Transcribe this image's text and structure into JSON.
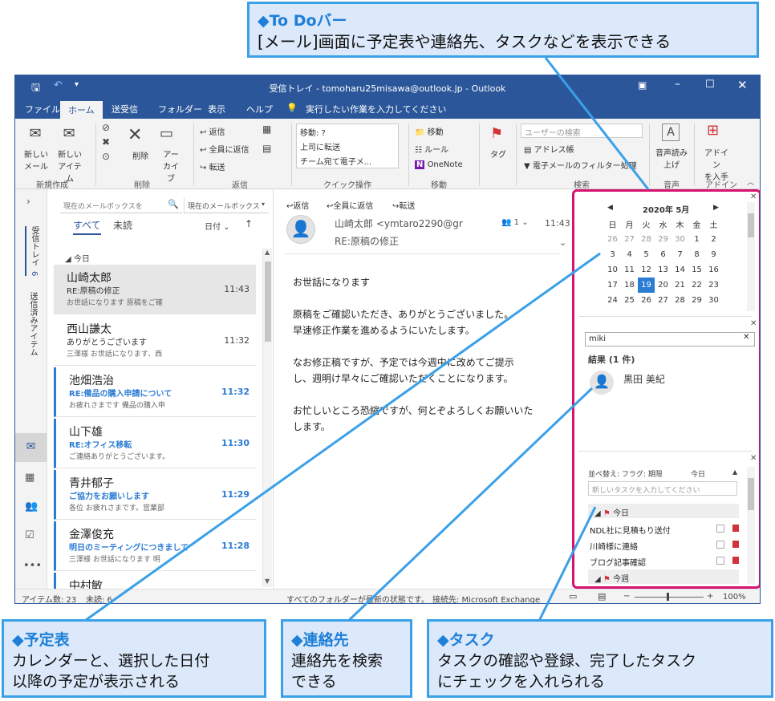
{
  "window": {
    "title": "受信トレイ - tomoharu25misawa@outlook.jp - Outlook"
  },
  "menu": [
    "ファイル",
    "ホーム",
    "送受信",
    "フォルダー",
    "表示",
    "ヘルプ"
  ],
  "tell_me": "実行したい作業を入力してください",
  "ribbon": {
    "new_mail": "新しい\nメール",
    "new_items": "新しい\nアイテム",
    "group_new": "新規作成",
    "delete": "削除",
    "archive": "アー\nカイブ",
    "group_delete": "削除",
    "reply": "返信",
    "reply_all": "全員に返信",
    "forward": "転送",
    "group_respond": "返信",
    "quick_steps": [
      "移動: ?",
      "上司に転送",
      "チーム宛て電子メ..."
    ],
    "group_quick": "クイック操作",
    "move": "移動",
    "rules": "ルール",
    "onenote": "OneNote",
    "group_move": "移動",
    "tags": "タグ",
    "search_people": "ユーザーの検索",
    "address_book": "アドレス帳",
    "filter_mail": "電子メールのフィルター処理",
    "group_find": "検索",
    "read_aloud": "音声読み\n上げ",
    "group_speech": "音声",
    "addins": "アドイン\nを入手",
    "group_addins": "アドイン"
  },
  "leftnav": {
    "inbox_label": "受信トレイ",
    "inbox_count": "6",
    "sent_label": "送信済みアイテム"
  },
  "mailbox_search": {
    "placeholder": "現在のメールボックスを",
    "scope": "現在のメールボックス"
  },
  "filters": {
    "all": "すべて",
    "unread": "未読",
    "sort": "日付"
  },
  "group_today": "今日",
  "messages": [
    {
      "sender": "山崎太郎",
      "subject": "RE:原稿の修正",
      "time": "11:43",
      "preview": "お世話になります 原稿をご確",
      "unread": false,
      "selected": true
    },
    {
      "sender": "西山謙太",
      "subject": "ありがとうございます",
      "time": "11:32",
      "preview": "三澤様 お世話になります、西",
      "unread": false,
      "selected": false
    },
    {
      "sender": "池畑浩治",
      "subject": "RE:備品の購入申請について",
      "time": "11:32",
      "preview": "お疲れさまです 備品の購入申",
      "unread": true,
      "selected": false
    },
    {
      "sender": "山下雄",
      "subject": "RE:オフィス移転",
      "time": "11:30",
      "preview": "ご連絡ありがとうございます。",
      "unread": true,
      "selected": false
    },
    {
      "sender": "青井郁子",
      "subject": "ご協力をお願いします",
      "time": "11:29",
      "preview": "各位 お疲れさまです。営業部",
      "unread": true,
      "selected": false
    },
    {
      "sender": "金澤俊充",
      "subject": "明日のミーティングにつきまして",
      "time": "11:28",
      "preview": "三澤様 お世話になります 明",
      "unread": true,
      "selected": false
    },
    {
      "sender": "中村敏",
      "subject": "",
      "time": "",
      "preview": "",
      "unread": true,
      "selected": false
    }
  ],
  "reading": {
    "actions": [
      "返信",
      "全員に返信",
      "転送"
    ],
    "from": "山崎太郎 <ymtaro2290@gr",
    "people_count": "1",
    "time": "11:43",
    "subject": "RE:原稿の修正",
    "body": [
      "お世話になります",
      "",
      "原稿をご確認いただき、ありがとうございました。",
      "早速修正作業を進めるようにいたします。",
      "",
      "なお修正稿ですが、予定では今週中に改めてご提示",
      "し、週明け早々にご確認いただくことになります。",
      "",
      "お忙しいところ恐縮ですが、何とぞよろしくお願いいた",
      "します。"
    ]
  },
  "calendar": {
    "month": "2020年 5月",
    "weekdays": [
      "日",
      "月",
      "火",
      "水",
      "木",
      "金",
      "土"
    ],
    "weeks": [
      [
        "26",
        "27",
        "28",
        "29",
        "30",
        "1",
        "2"
      ],
      [
        "3",
        "4",
        "5",
        "6",
        "7",
        "8",
        "9"
      ],
      [
        "10",
        "11",
        "12",
        "13",
        "14",
        "15",
        "16"
      ],
      [
        "17",
        "18",
        "19",
        "20",
        "21",
        "22",
        "23"
      ],
      [
        "24",
        "25",
        "26",
        "27",
        "28",
        "29",
        "30"
      ]
    ],
    "today": "19"
  },
  "people": {
    "search_value": "miki",
    "result_header": "結果 (1 件)",
    "result_name": "黒田 美紀"
  },
  "tasks": {
    "sort_label": "並べ替え: フラグ: 期限",
    "sort_value": "今日",
    "new_placeholder": "新しいタスクを入力してください",
    "group_today": "今日",
    "items": [
      "NDL社に見積もり送付",
      "川崎様に連絡",
      "ブログ記事確認"
    ],
    "group_week": "今週"
  },
  "status": {
    "items": "アイテム数: 23",
    "unread": "未読: 6",
    "sync": "すべてのフォルダーが最新の状態です。",
    "connection": "接続先: Microsoft Exchange",
    "zoom": "100%"
  },
  "callouts": {
    "todo_title": "◆To Doバー",
    "todo_body": "[メール]画面に予定表や連絡先、タスクなどを表示できる",
    "cal_title": "◆予定表",
    "cal_body1": "カレンダーと、選択した日付",
    "cal_body2": "以降の予定が表示される",
    "contacts_title": "◆連絡先",
    "contacts_body1": "連絡先を検索",
    "contacts_body2": "できる",
    "tasks_title": "◆タスク",
    "tasks_body1": "タスクの確認や登録、完了したタスク",
    "tasks_body2": "にチェックを入れられる"
  },
  "colors": {
    "accent": "#2b579a",
    "highlight": "#d6136f",
    "callout_border": "#3aa0e8",
    "callout_fill": "#dbe9fb"
  }
}
